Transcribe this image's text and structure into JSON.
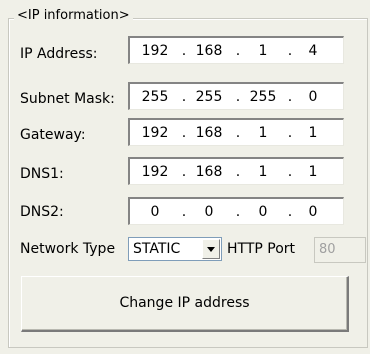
{
  "group": {
    "title": "<IP information>"
  },
  "ip_address": {
    "label": "IP Address:",
    "octets": [
      "192",
      "168",
      "1",
      "4"
    ]
  },
  "subnet_mask": {
    "label": "Subnet Mask:",
    "octets": [
      "255",
      "255",
      "255",
      "0"
    ]
  },
  "gateway": {
    "label": "Gateway:",
    "octets": [
      "192",
      "168",
      "1",
      "1"
    ]
  },
  "dns1": {
    "label": "DNS1:",
    "octets": [
      "192",
      "168",
      "1",
      "1"
    ]
  },
  "dns2": {
    "label": "DNS2:",
    "octets": [
      "0",
      "0",
      "0",
      "0"
    ]
  },
  "network_type": {
    "label": "Network Type",
    "selected": "STATIC"
  },
  "http_port": {
    "label": "HTTP Port",
    "value": "80"
  },
  "separator": ".",
  "change_button": {
    "label": "Change IP address"
  },
  "colors": {
    "background": "#f0f0e8",
    "field_background": "#ffffff",
    "disabled_text": "#a0a0a0"
  },
  "icons": {
    "dropdown": "chevron-down-icon"
  }
}
